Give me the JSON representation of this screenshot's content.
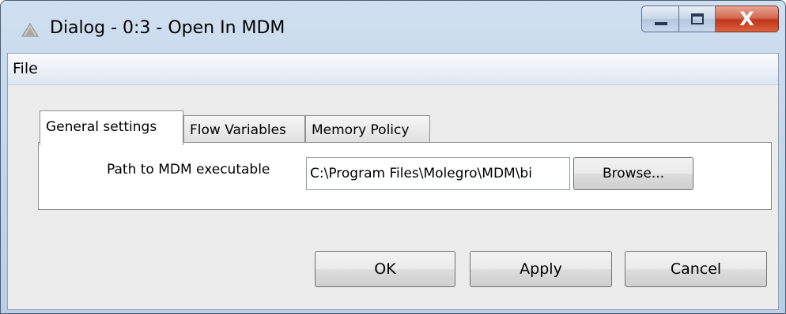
{
  "window": {
    "title": "Dialog - 0:3 - Open In MDM",
    "controls": {
      "minimize_icon": "minimize-icon",
      "maximize_icon": "maximize-icon",
      "close_symbol": "X"
    }
  },
  "menu": {
    "items": [
      {
        "label": "File"
      }
    ]
  },
  "tabs": [
    {
      "label": "General settings",
      "active": true
    },
    {
      "label": "Flow Variables",
      "active": false
    },
    {
      "label": "Memory Policy",
      "active": false
    }
  ],
  "general": {
    "path_label": "Path to MDM executable",
    "path_value": "C:\\Program Files\\Molegro\\MDM\\bi",
    "browse_label": "Browse..."
  },
  "buttons": {
    "ok": "OK",
    "apply": "Apply",
    "cancel": "Cancel"
  },
  "colors": {
    "titlebar": "#c4d7ec",
    "close_button": "#c2341a",
    "menubar": "#e6ecf5",
    "dialog_bg": "#ececec"
  }
}
